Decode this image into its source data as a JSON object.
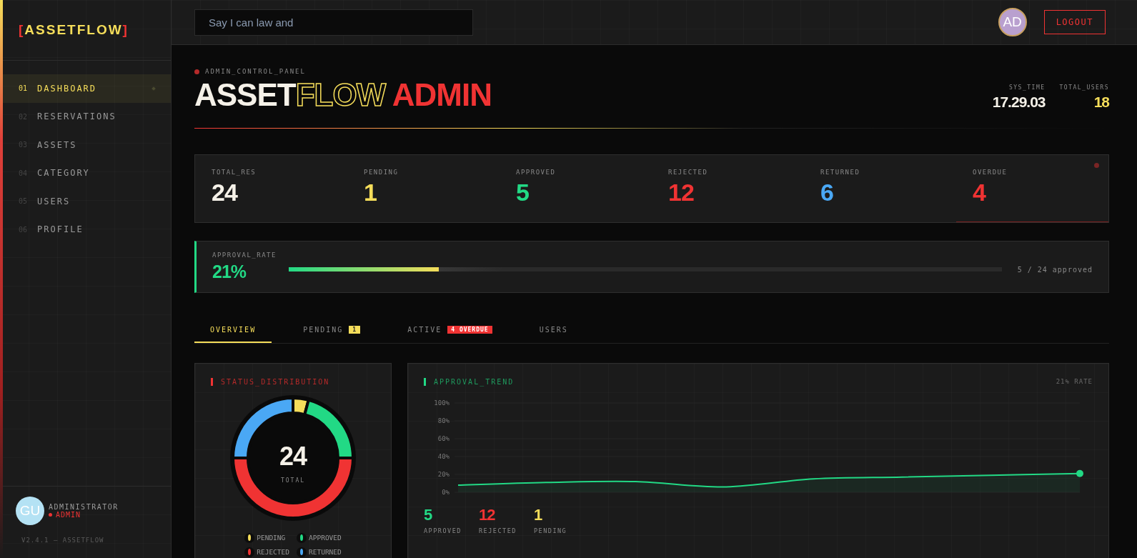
{
  "sidebar": {
    "logo": {
      "open": "[",
      "name": "ASSETFLOW",
      "close": "]"
    },
    "items": [
      {
        "number": "01",
        "label": "DASHBOARD",
        "selected": true
      },
      {
        "number": "02",
        "label": "RESERVATIONS",
        "selected": false
      },
      {
        "number": "03",
        "label": "ASSETS",
        "selected": false
      },
      {
        "number": "04",
        "label": "CATEGORY",
        "selected": false
      },
      {
        "number": "05",
        "label": "USERS",
        "selected": false
      },
      {
        "number": "06",
        "label": "PROFILE",
        "selected": false
      }
    ],
    "user": {
      "initials": "GU",
      "name": "ADMINISTRATOR",
      "role": "ADMIN"
    },
    "version": "V2.4.1 — ASSETFLOW"
  },
  "topbar": {
    "search": {
      "placeholder": "Say I can law and"
    },
    "avatar": "AD",
    "logout": "LOGOUT"
  },
  "header": {
    "eyebrow": "ADMIN_CONTROL_PANEL",
    "title": [
      {
        "text": "ASSET",
        "kind": "solid"
      },
      {
        "text": "FLOW",
        "kind": "outline"
      },
      {
        "text": " ADMIN",
        "kind": "accent"
      }
    ],
    "meta": [
      {
        "label": "SYS_TIME",
        "value": "17.29.03",
        "color": "#f5f1e8"
      },
      {
        "label": "TOTAL_USERS",
        "value": "18",
        "color": "#f5dd5a"
      }
    ]
  },
  "stats": [
    {
      "label": "TOTAL_RES",
      "value": "24",
      "color": "#f5f1e8",
      "alert": false
    },
    {
      "label": "PENDING",
      "value": "1",
      "color": "#f5dd5a",
      "alert": false
    },
    {
      "label": "APPROVED",
      "value": "5",
      "color": "#22d985",
      "alert": false
    },
    {
      "label": "REJECTED",
      "value": "12",
      "color": "#f03333",
      "alert": false
    },
    {
      "label": "RETURNED",
      "value": "6",
      "color": "#4aa8f5",
      "alert": false
    },
    {
      "label": "OVERDUE",
      "value": "4",
      "color": "#f03333",
      "alert": true
    }
  ],
  "approval": {
    "label": "APPROVAL_RATE",
    "value": "21%",
    "level": 0.21,
    "summary": "5 / 24 approved"
  },
  "tabs": [
    {
      "label": "OVERVIEW",
      "selected": true
    },
    {
      "label": "PENDING",
      "selected": false,
      "badge": {
        "text": "1",
        "color": "#f5dd5a"
      }
    },
    {
      "label": "ACTIVE",
      "selected": false,
      "badge": {
        "text": "4 OVERDUE",
        "color": "#f03333"
      }
    },
    {
      "label": "USERS",
      "selected": false
    }
  ],
  "distribution": {
    "title": "STATUS_DISTRIBUTION",
    "total": "24",
    "total_label": "TOTAL",
    "chart_data": {
      "type": "donut",
      "categories": [
        "PENDING",
        "APPROVED",
        "REJECTED",
        "RETURNED"
      ],
      "values": [
        4.17,
        20.83,
        50,
        25
      ],
      "colors": [
        "#f5dd5a",
        "#22d985",
        "#f03333",
        "#4aa8f5"
      ]
    }
  },
  "trend": {
    "title": "APPROVAL_TREND",
    "rate": "21% RATE",
    "axis_labels": [
      "100%",
      "80%",
      "60%",
      "40%",
      "20%",
      "0%"
    ],
    "summary": [
      {
        "value": "5",
        "label": "APPROVED",
        "color": "#22d985"
      },
      {
        "value": "12",
        "label": "REJECTED",
        "color": "#f03333"
      },
      {
        "value": "1",
        "label": "PENDING",
        "color": "#f5dd5a"
      }
    ]
  }
}
